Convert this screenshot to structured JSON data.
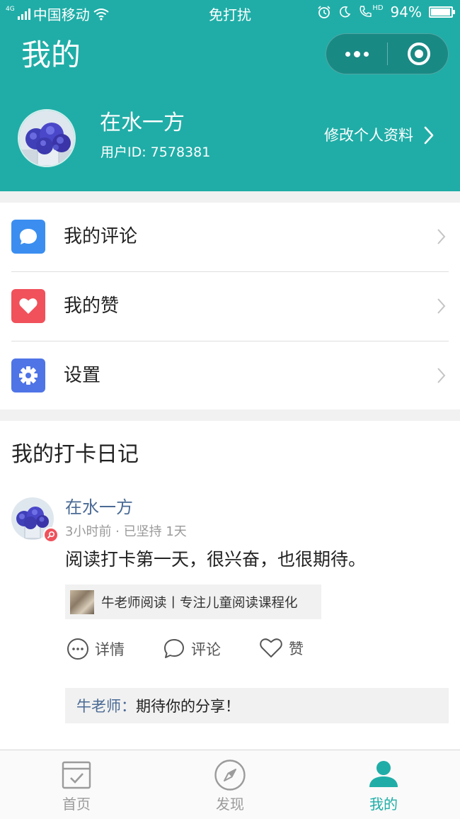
{
  "status_bar": {
    "network": "4G",
    "carrier": "中国移动",
    "mode": "免打扰",
    "hd": "HD",
    "battery": "94%",
    "battery_level": 0.94
  },
  "header": {
    "title": "我的",
    "more_icon": "ellipsis-icon",
    "close_icon": "target-icon"
  },
  "profile": {
    "username": "在水一方",
    "user_id_text": "用户ID: 7578381",
    "edit_label": "修改个人资料"
  },
  "menu": {
    "items": [
      {
        "label": "我的评论",
        "icon": "comment-icon",
        "color": "#3b8ef0"
      },
      {
        "label": "我的赞",
        "icon": "heart-icon",
        "color": "#f0515b"
      },
      {
        "label": "设置",
        "icon": "gear-icon",
        "color": "#4f74e6"
      }
    ]
  },
  "diary": {
    "title": "我的打卡日记",
    "post": {
      "author": "在水一方",
      "meta": "3小时前 · 已坚持 1天",
      "text": "阅读打卡第一天，很兴奋，也很期待。",
      "link_text": "牛老师阅读丨专注儿童阅读课程化",
      "actions": {
        "detail": "详情",
        "comment": "评论",
        "like": "赞"
      },
      "reply": {
        "author": "牛老师：",
        "text": "期待你的分享！"
      }
    }
  },
  "tabbar": {
    "accent_color": "#20ada7",
    "tabs": [
      {
        "label": "首页",
        "icon": "calendar-check-icon",
        "active": false
      },
      {
        "label": "发现",
        "icon": "compass-icon",
        "active": false
      },
      {
        "label": "我的",
        "icon": "person-icon",
        "active": true
      }
    ]
  }
}
